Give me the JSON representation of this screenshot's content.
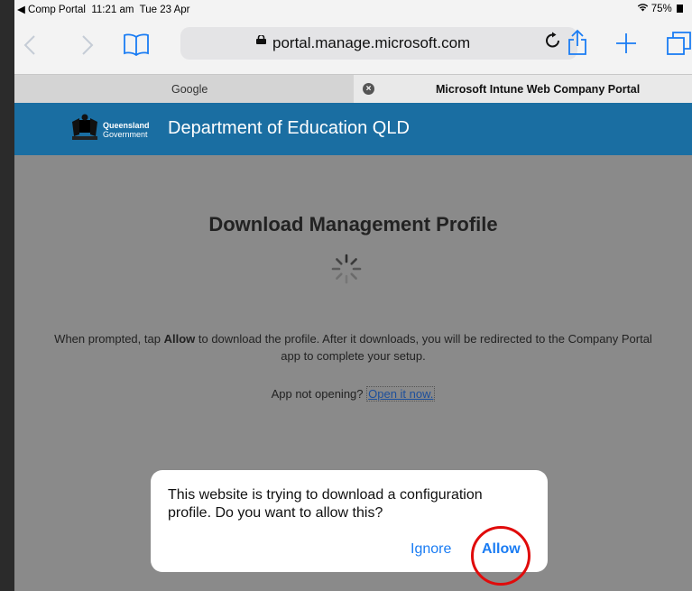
{
  "statusbar": {
    "back_app": "◀ Comp Portal",
    "time": "11:21 am",
    "date": "Tue 23 Apr",
    "battery": "75%"
  },
  "toolbar": {
    "url": "portal.manage.microsoft.com"
  },
  "tabs": [
    {
      "label": "Google"
    },
    {
      "label": "Microsoft Intune Web Company Portal"
    }
  ],
  "banner": {
    "logo_line1": "Queensland",
    "logo_line2": "Government",
    "title": "Department of Education QLD"
  },
  "page": {
    "heading": "Download Management Profile",
    "desc_before": "When prompted, tap ",
    "desc_bold": "Allow",
    "desc_after": " to download the profile. After it downloads, you will be redirected to the Company Portal app to complete your setup.",
    "not_opening": "App not opening? ",
    "open_link": "Open it now."
  },
  "dialog": {
    "message": "This website is trying to download a configuration profile. Do you want to allow this?",
    "ignore": "Ignore",
    "allow": "Allow"
  },
  "colors": {
    "banner": "#1a6ea2",
    "accent": "#1a7cf3",
    "highlight_ring": "#e00b0b"
  }
}
